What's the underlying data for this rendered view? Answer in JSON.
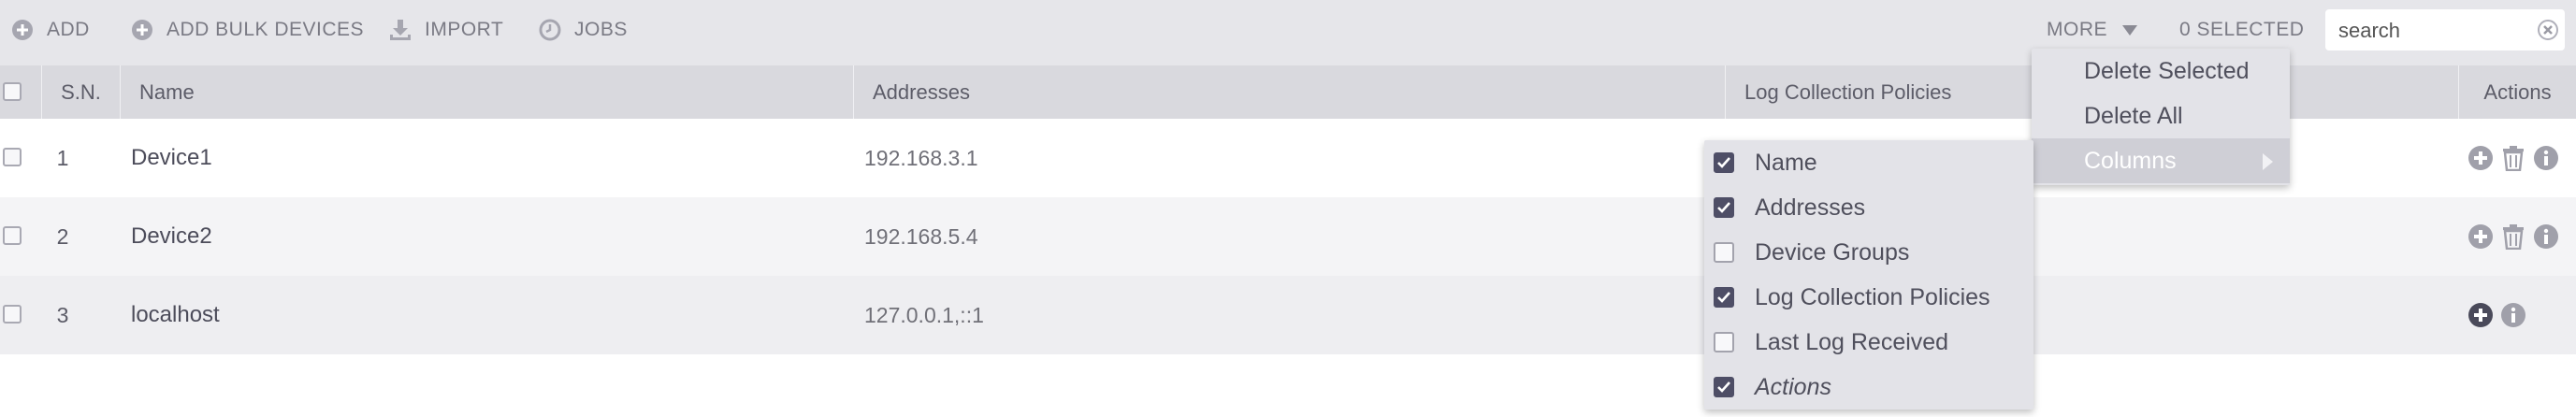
{
  "toolbar": {
    "add_label": "ADD",
    "add_bulk_label": "ADD BULK DEVICES",
    "import_label": "IMPORT",
    "jobs_label": "JOBS",
    "more_label": "MORE",
    "selected_label": "0 SELECTED",
    "search_placeholder": "search"
  },
  "table": {
    "columns": {
      "sn": "S.N.",
      "name": "Name",
      "addresses": "Addresses",
      "log_policies": "Log Collection Policies",
      "actions": "Actions"
    },
    "rows": [
      {
        "sn": "1",
        "name": "Device1",
        "addresses": "192.168.3.1"
      },
      {
        "sn": "2",
        "name": "Device2",
        "addresses": "192.168.5.4"
      },
      {
        "sn": "3",
        "name": "localhost",
        "addresses": "127.0.0.1,::1"
      }
    ]
  },
  "more_menu": {
    "items": [
      "Delete Selected",
      "Delete All",
      "Columns"
    ]
  },
  "columns_menu": {
    "items": [
      {
        "label": "Name",
        "checked": true
      },
      {
        "label": "Addresses",
        "checked": true
      },
      {
        "label": "Device Groups",
        "checked": false
      },
      {
        "label": "Log Collection Policies",
        "checked": true
      },
      {
        "label": "Last Log Received",
        "checked": false
      },
      {
        "label": "Actions",
        "checked": true
      }
    ]
  },
  "colors": {
    "toolbar_bg": "#e6e6ea",
    "header_bg": "#d9d9de",
    "row_alt_bg": "#f4f4f6",
    "checkbox_checked": "#4e4e66",
    "icon_gray": "#a0a0aa",
    "icon_dark": "#4a4a5a"
  },
  "icons": {
    "add": "plus-circle-icon",
    "import": "download-icon",
    "jobs": "clock-icon",
    "clear": "close-circle-icon",
    "row_add": "plus-circle-icon",
    "row_delete": "trash-icon",
    "row_info": "info-icon"
  }
}
